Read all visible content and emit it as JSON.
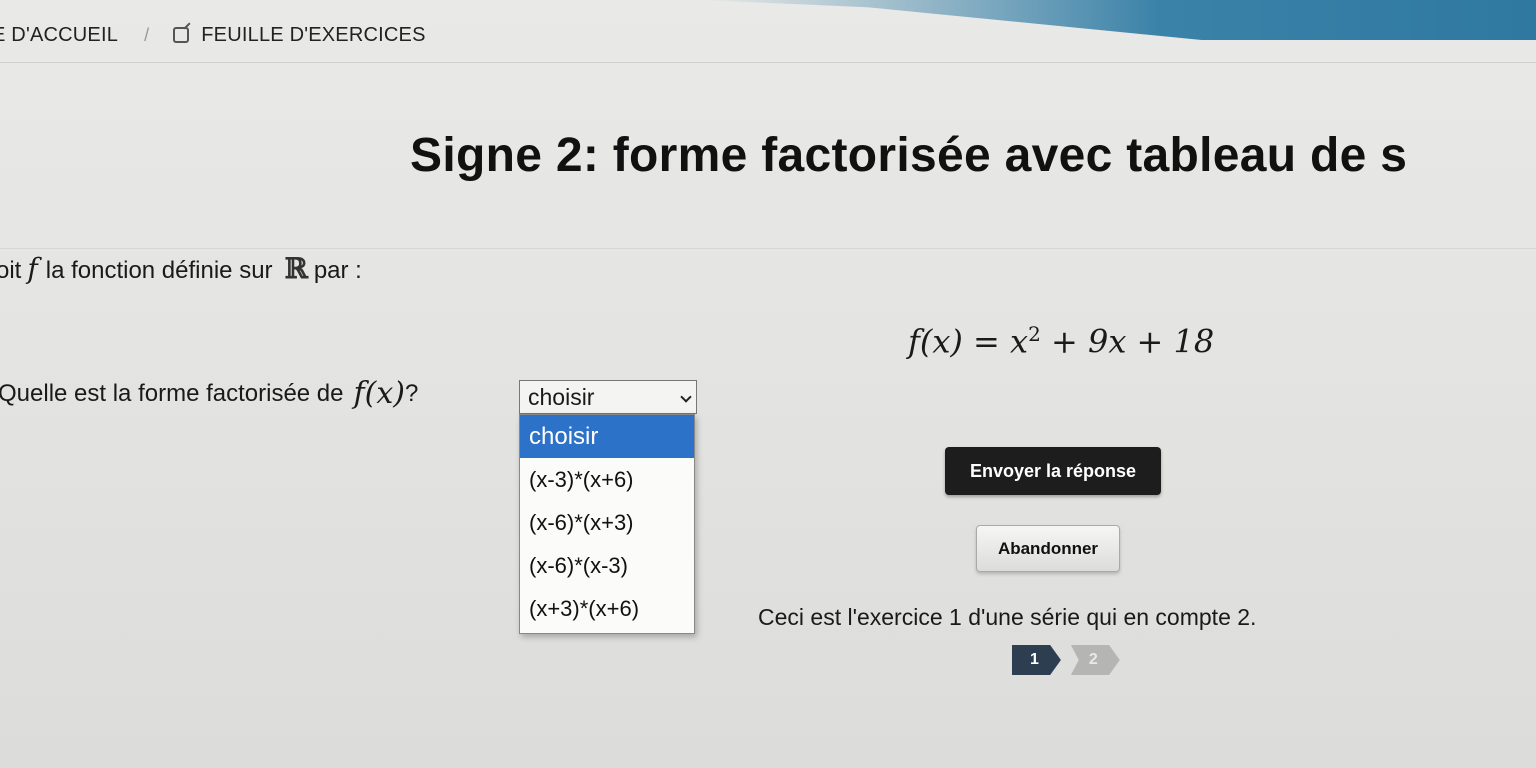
{
  "breadcrumb": {
    "home": "E D'ACCUEIL",
    "separator": "/",
    "current": "FEUILLE D'EXERCICES"
  },
  "title": "Signe 2: forme factorisée avec tableau de s",
  "statement": {
    "prefix": "oit",
    "fn": "f",
    "middle": "la fonction définie sur",
    "set": "ℝ",
    "suffix": "par :"
  },
  "formula": {
    "lhs": "f(x) = x",
    "exp": "2",
    "rhs": " + 9x + 18"
  },
  "question": {
    "text": "Quelle est la forme factorisée de",
    "fx": "f(x)",
    "mark": "?"
  },
  "select": {
    "value": "choisir",
    "options": [
      "choisir",
      "(x-3)*(x+6)",
      "(x-6)*(x+3)",
      "(x-6)*(x-3)",
      "(x+3)*(x+6)"
    ]
  },
  "buttons": {
    "submit": "Envoyer la réponse",
    "abandon": "Abandonner"
  },
  "series": {
    "text": "Ceci est l'exercice 1 d'une série qui en compte 2.",
    "steps": [
      "1",
      "2"
    ]
  },
  "colors": {
    "accent": "#3b82a8",
    "selected_option": "#2b72c8",
    "submit_button": "#1d1d1d",
    "current_step": "#2c3e50"
  }
}
